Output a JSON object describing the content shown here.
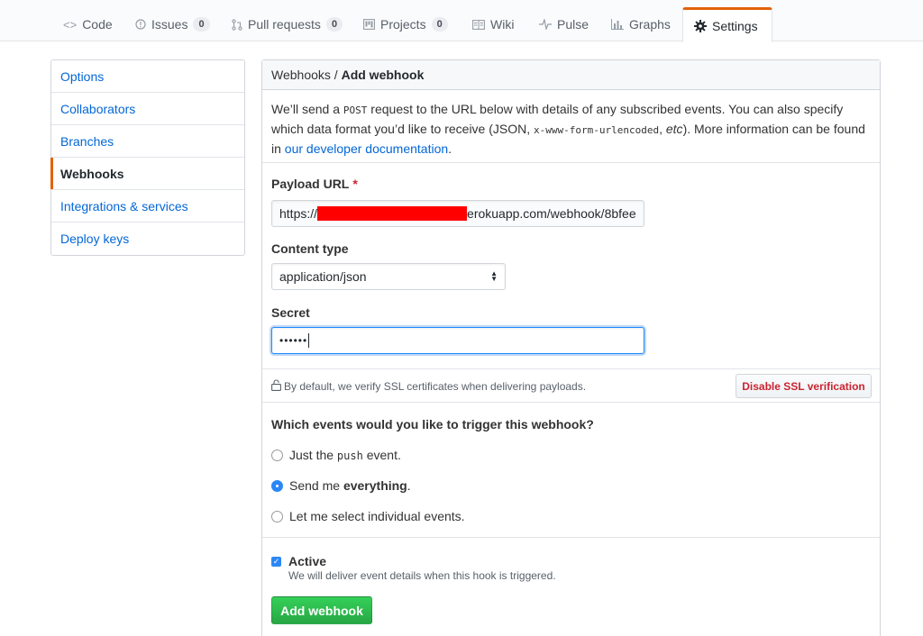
{
  "nav": {
    "tabs": [
      {
        "label": "Code",
        "icon": "code-icon"
      },
      {
        "label": "Issues",
        "count": "0",
        "icon": "issue-icon"
      },
      {
        "label": "Pull requests",
        "count": "0",
        "icon": "pull-request-icon"
      },
      {
        "label": "Projects",
        "count": "0",
        "icon": "project-icon"
      },
      {
        "label": "Wiki",
        "icon": "book-icon"
      },
      {
        "label": "Pulse",
        "icon": "pulse-icon"
      },
      {
        "label": "Graphs",
        "icon": "graph-icon"
      },
      {
        "label": "Settings",
        "icon": "gear-icon",
        "selected": true
      }
    ]
  },
  "sidebar": {
    "items": [
      {
        "label": "Options"
      },
      {
        "label": "Collaborators"
      },
      {
        "label": "Branches"
      },
      {
        "label": "Webhooks",
        "active": true
      },
      {
        "label": "Integrations & services"
      },
      {
        "label": "Deploy keys"
      }
    ]
  },
  "header": {
    "breadcrumb_parent": "Webhooks",
    "breadcrumb_separator": " / ",
    "breadcrumb_current": "Add webhook"
  },
  "intro": {
    "part1": "We’ll send a ",
    "method": "POST",
    "part2": " request to the URL below with details of any subscribed events. You can also specify which data format you’d like to receive (JSON, ",
    "encoding": "x-www-form-urlencoded",
    "part3": ", ",
    "etc": "etc",
    "part4": "). More information can be found in ",
    "link": "our developer documentation",
    "part5": "."
  },
  "form": {
    "payload_label": "Payload URL",
    "required_mark": "*",
    "payload_prefix": "https://",
    "payload_suffix": "erokuapp.com/webhook/8bfee",
    "content_type_label": "Content type",
    "content_type_value": "application/json",
    "secret_label": "Secret",
    "secret_value": "••••••",
    "ssl_note": "By default, we verify SSL certificates when delivering payloads.",
    "ssl_button": "Disable SSL verification",
    "events_question": "Which events would you like to trigger this webhook?",
    "option_push_pre": "Just the ",
    "option_push_code": "push",
    "option_push_post": " event.",
    "option_all_pre": "Send me ",
    "option_all_bold": "everything",
    "option_all_post": ".",
    "option_select": "Let me select individual events.",
    "active_label": "Active",
    "active_note": "We will deliver event details when this hook is triggered.",
    "submit": "Add webhook"
  },
  "colors": {
    "link": "#0366d6",
    "accent_orange": "#e36209",
    "danger": "#cb2431",
    "primary_green": "#28a745",
    "check_blue": "#2b87f6",
    "redaction": "#ff0000"
  }
}
